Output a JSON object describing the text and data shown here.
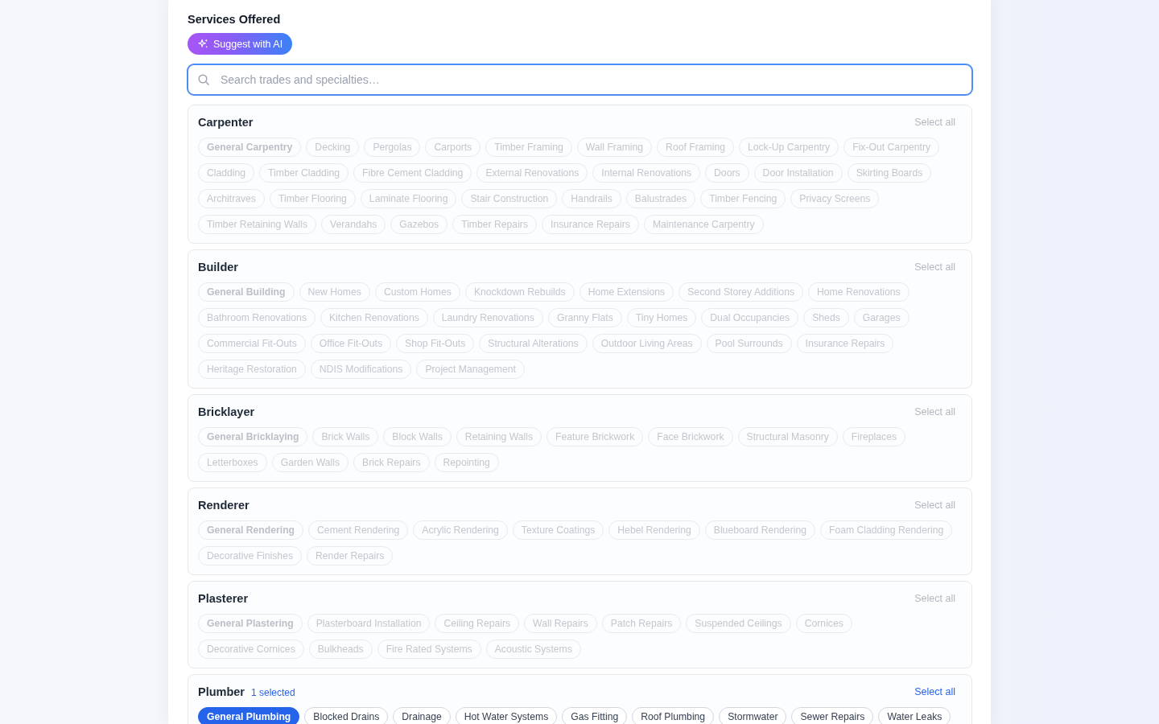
{
  "section": {
    "title": "Services Offered",
    "suggest_button": "Suggest with AI",
    "search": {
      "placeholder": "Search trades and specialties…"
    }
  },
  "groups": [
    {
      "title": "Carpenter",
      "select_all": "Select all",
      "disabled": true,
      "chips": [
        {
          "label": "General Carpentry",
          "kind": "general",
          "selected": false
        },
        {
          "label": "Decking",
          "kind": "specialty",
          "selected": false
        },
        {
          "label": "Pergolas",
          "kind": "specialty",
          "selected": false
        },
        {
          "label": "Carports",
          "kind": "specialty",
          "selected": false
        },
        {
          "label": "Timber Framing",
          "kind": "specialty",
          "selected": false
        },
        {
          "label": "Wall Framing",
          "kind": "specialty",
          "selected": false
        },
        {
          "label": "Roof Framing",
          "kind": "specialty",
          "selected": false
        },
        {
          "label": "Lock-Up Carpentry",
          "kind": "specialty",
          "selected": false
        },
        {
          "label": "Fix-Out Carpentry",
          "kind": "specialty",
          "selected": false
        },
        {
          "label": "Cladding",
          "kind": "specialty",
          "selected": false
        },
        {
          "label": "Timber Cladding",
          "kind": "specialty",
          "selected": false
        },
        {
          "label": "Fibre Cement Cladding",
          "kind": "specialty",
          "selected": false
        },
        {
          "label": "External Renovations",
          "kind": "specialty",
          "selected": false
        },
        {
          "label": "Internal Renovations",
          "kind": "specialty",
          "selected": false
        },
        {
          "label": "Doors",
          "kind": "specialty",
          "selected": false
        },
        {
          "label": "Door Installation",
          "kind": "specialty",
          "selected": false
        },
        {
          "label": "Skirting Boards",
          "kind": "specialty",
          "selected": false
        },
        {
          "label": "Architraves",
          "kind": "specialty",
          "selected": false
        },
        {
          "label": "Timber Flooring",
          "kind": "specialty",
          "selected": false
        },
        {
          "label": "Laminate Flooring",
          "kind": "specialty",
          "selected": false
        },
        {
          "label": "Stair Construction",
          "kind": "specialty",
          "selected": false
        },
        {
          "label": "Handrails",
          "kind": "specialty",
          "selected": false
        },
        {
          "label": "Balustrades",
          "kind": "specialty",
          "selected": false
        },
        {
          "label": "Timber Fencing",
          "kind": "specialty",
          "selected": false
        },
        {
          "label": "Privacy Screens",
          "kind": "specialty",
          "selected": false
        },
        {
          "label": "Timber Retaining Walls",
          "kind": "specialty",
          "selected": false
        },
        {
          "label": "Verandahs",
          "kind": "specialty",
          "selected": false
        },
        {
          "label": "Gazebos",
          "kind": "specialty",
          "selected": false
        },
        {
          "label": "Timber Repairs",
          "kind": "specialty",
          "selected": false
        },
        {
          "label": "Insurance Repairs",
          "kind": "specialty",
          "selected": false
        },
        {
          "label": "Maintenance Carpentry",
          "kind": "specialty",
          "selected": false
        }
      ]
    },
    {
      "title": "Builder",
      "select_all": "Select all",
      "disabled": true,
      "chips": [
        {
          "label": "General Building",
          "kind": "general",
          "selected": false
        },
        {
          "label": "New Homes",
          "kind": "specialty",
          "selected": false
        },
        {
          "label": "Custom Homes",
          "kind": "specialty",
          "selected": false
        },
        {
          "label": "Knockdown Rebuilds",
          "kind": "specialty",
          "selected": false
        },
        {
          "label": "Home Extensions",
          "kind": "specialty",
          "selected": false
        },
        {
          "label": "Second Storey Additions",
          "kind": "specialty",
          "selected": false
        },
        {
          "label": "Home Renovations",
          "kind": "specialty",
          "selected": false
        },
        {
          "label": "Bathroom Renovations",
          "kind": "specialty",
          "selected": false
        },
        {
          "label": "Kitchen Renovations",
          "kind": "specialty",
          "selected": false
        },
        {
          "label": "Laundry Renovations",
          "kind": "specialty",
          "selected": false
        },
        {
          "label": "Granny Flats",
          "kind": "specialty",
          "selected": false
        },
        {
          "label": "Tiny Homes",
          "kind": "specialty",
          "selected": false
        },
        {
          "label": "Dual Occupancies",
          "kind": "specialty",
          "selected": false
        },
        {
          "label": "Sheds",
          "kind": "specialty",
          "selected": false
        },
        {
          "label": "Garages",
          "kind": "specialty",
          "selected": false
        },
        {
          "label": "Commercial Fit-Outs",
          "kind": "specialty",
          "selected": false
        },
        {
          "label": "Office Fit-Outs",
          "kind": "specialty",
          "selected": false
        },
        {
          "label": "Shop Fit-Outs",
          "kind": "specialty",
          "selected": false
        },
        {
          "label": "Structural Alterations",
          "kind": "specialty",
          "selected": false
        },
        {
          "label": "Outdoor Living Areas",
          "kind": "specialty",
          "selected": false
        },
        {
          "label": "Pool Surrounds",
          "kind": "specialty",
          "selected": false
        },
        {
          "label": "Insurance Repairs",
          "kind": "specialty",
          "selected": false
        },
        {
          "label": "Heritage Restoration",
          "kind": "specialty",
          "selected": false
        },
        {
          "label": "NDIS Modifications",
          "kind": "specialty",
          "selected": false
        },
        {
          "label": "Project Management",
          "kind": "specialty",
          "selected": false
        }
      ]
    },
    {
      "title": "Bricklayer",
      "select_all": "Select all",
      "disabled": true,
      "chips": [
        {
          "label": "General Bricklaying",
          "kind": "general",
          "selected": false
        },
        {
          "label": "Brick Walls",
          "kind": "specialty",
          "selected": false
        },
        {
          "label": "Block Walls",
          "kind": "specialty",
          "selected": false
        },
        {
          "label": "Retaining Walls",
          "kind": "specialty",
          "selected": false
        },
        {
          "label": "Feature Brickwork",
          "kind": "specialty",
          "selected": false
        },
        {
          "label": "Face Brickwork",
          "kind": "specialty",
          "selected": false
        },
        {
          "label": "Structural Masonry",
          "kind": "specialty",
          "selected": false
        },
        {
          "label": "Fireplaces",
          "kind": "specialty",
          "selected": false
        },
        {
          "label": "Letterboxes",
          "kind": "specialty",
          "selected": false
        },
        {
          "label": "Garden Walls",
          "kind": "specialty",
          "selected": false
        },
        {
          "label": "Brick Repairs",
          "kind": "specialty",
          "selected": false
        },
        {
          "label": "Repointing",
          "kind": "specialty",
          "selected": false
        }
      ]
    },
    {
      "title": "Renderer",
      "select_all": "Select all",
      "disabled": true,
      "chips": [
        {
          "label": "General Rendering",
          "kind": "general",
          "selected": false
        },
        {
          "label": "Cement Rendering",
          "kind": "specialty",
          "selected": false
        },
        {
          "label": "Acrylic Rendering",
          "kind": "specialty",
          "selected": false
        },
        {
          "label": "Texture Coatings",
          "kind": "specialty",
          "selected": false
        },
        {
          "label": "Hebel Rendering",
          "kind": "specialty",
          "selected": false
        },
        {
          "label": "Blueboard Rendering",
          "kind": "specialty",
          "selected": false
        },
        {
          "label": "Foam Cladding Rendering",
          "kind": "specialty",
          "selected": false
        },
        {
          "label": "Decorative Finishes",
          "kind": "specialty",
          "selected": false
        },
        {
          "label": "Render Repairs",
          "kind": "specialty",
          "selected": false
        }
      ]
    },
    {
      "title": "Plasterer",
      "select_all": "Select all",
      "disabled": true,
      "chips": [
        {
          "label": "General Plastering",
          "kind": "general",
          "selected": false
        },
        {
          "label": "Plasterboard Installation",
          "kind": "specialty",
          "selected": false
        },
        {
          "label": "Ceiling Repairs",
          "kind": "specialty",
          "selected": false
        },
        {
          "label": "Wall Repairs",
          "kind": "specialty",
          "selected": false
        },
        {
          "label": "Patch Repairs",
          "kind": "specialty",
          "selected": false
        },
        {
          "label": "Suspended Ceilings",
          "kind": "specialty",
          "selected": false
        },
        {
          "label": "Cornices",
          "kind": "specialty",
          "selected": false
        },
        {
          "label": "Decorative Cornices",
          "kind": "specialty",
          "selected": false
        },
        {
          "label": "Bulkheads",
          "kind": "specialty",
          "selected": false
        },
        {
          "label": "Fire Rated Systems",
          "kind": "specialty",
          "selected": false
        },
        {
          "label": "Acoustic Systems",
          "kind": "specialty",
          "selected": false
        }
      ]
    },
    {
      "title": "Plumber",
      "selected_count": "1 selected",
      "select_all": "Select all",
      "disabled": false,
      "chips": [
        {
          "label": "General Plumbing",
          "kind": "general",
          "selected": true
        },
        {
          "label": "Blocked Drains",
          "kind": "specialty",
          "selected": false
        },
        {
          "label": "Drainage",
          "kind": "specialty",
          "selected": false
        },
        {
          "label": "Hot Water Systems",
          "kind": "specialty",
          "selected": false
        },
        {
          "label": "Gas Fitting",
          "kind": "specialty",
          "selected": false
        },
        {
          "label": "Roof Plumbing",
          "kind": "specialty",
          "selected": false
        },
        {
          "label": "Stormwater",
          "kind": "specialty",
          "selected": false
        },
        {
          "label": "Sewer Repairs",
          "kind": "specialty",
          "selected": false
        },
        {
          "label": "Water Leaks",
          "kind": "specialty",
          "selected": false
        }
      ]
    }
  ]
}
